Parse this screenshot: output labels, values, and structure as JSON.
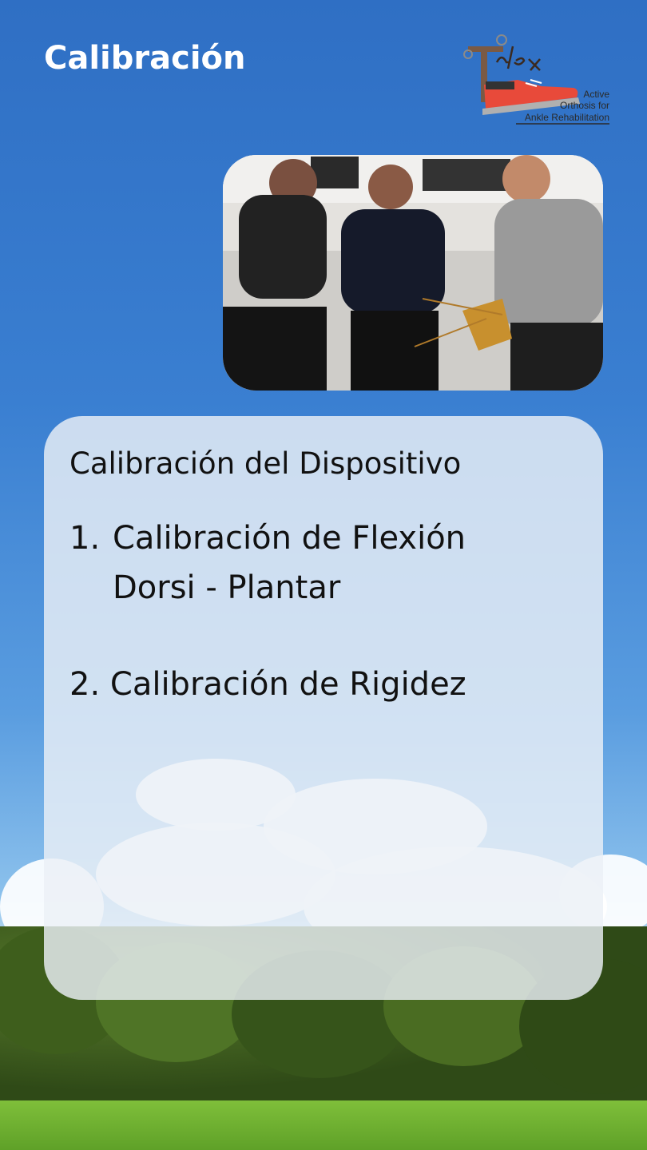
{
  "header": {
    "title": "Calibración"
  },
  "logo": {
    "name": "T-flex",
    "line1": "Active",
    "line2": "Orthosis for",
    "line3": "Ankle Rehabilitation"
  },
  "photo": {
    "alt": "Equipo calibrando la ortesis de tobillo"
  },
  "card": {
    "heading": "Calibración del Dispositivo",
    "items": [
      {
        "number": "1.",
        "label": "Calibración de Flexión Dorsi - Plantar"
      },
      {
        "number": "2.",
        "label": "Calibración de Rigidez"
      }
    ]
  },
  "colors": {
    "sky": "#3a7fd1",
    "card": "#ebf0f7",
    "title_text": "#ffffff",
    "logo_accent": "#e84a3a"
  }
}
